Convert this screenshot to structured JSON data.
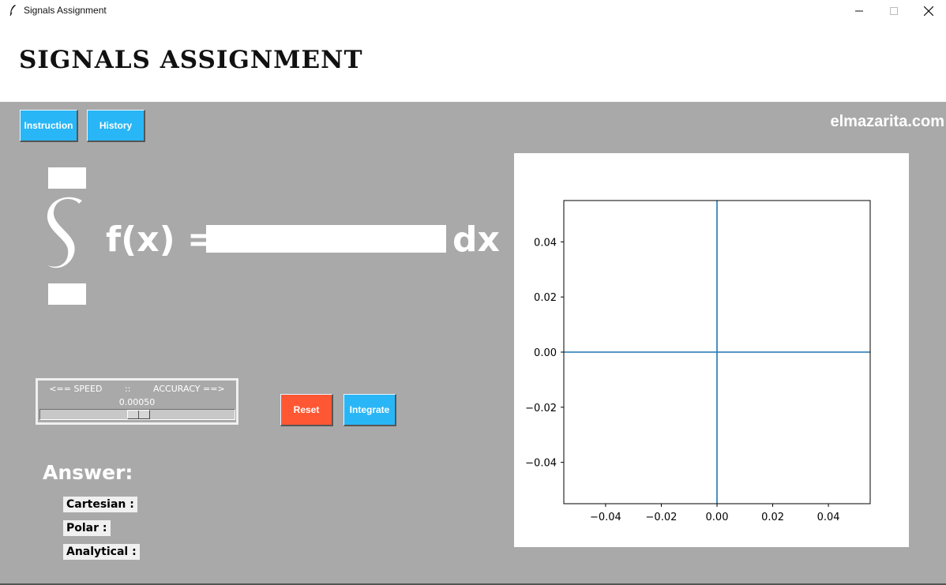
{
  "window": {
    "title": "Signals Assignment",
    "controls": [
      "minimize-icon",
      "maximize-icon",
      "close-icon"
    ]
  },
  "header": {
    "heading": "SIGNALS ASSIGNMENT"
  },
  "toolbar": {
    "instruction_label": "Instruction",
    "history_label": "History"
  },
  "site": "elmazarita.com",
  "integral": {
    "symbol": "S",
    "fx_label": "f(x) =",
    "dx_label": "dx",
    "upper_limit": "",
    "lower_limit": "",
    "function_value": ""
  },
  "scale": {
    "left_label": "<== SPEED",
    "sep_label": "::",
    "right_label": "ACCURACY ==>",
    "value": "0.00050"
  },
  "actions": {
    "reset_label": "Reset",
    "integrate_label": "Integrate"
  },
  "answer": {
    "title": "Answer:",
    "cartesian_label": "Cartesian :",
    "polar_label": "Polar :",
    "analytical_label": "Analytical :"
  },
  "colors": {
    "blue": "#29b6f6",
    "red": "#ff5733",
    "panel": "#a9a9a9",
    "line": "#1f77b4"
  },
  "chart_data": {
    "type": "line",
    "title": "",
    "xlabel": "",
    "ylabel": "",
    "xlim": [
      -0.055,
      0.055
    ],
    "ylim": [
      -0.055,
      0.055
    ],
    "xticks": [
      "−0.04",
      "−0.02",
      "0.00",
      "0.02",
      "0.04"
    ],
    "yticks": [
      "0.04",
      "0.02",
      "0.00",
      "−0.02",
      "−0.04"
    ],
    "xtick_values": [
      -0.04,
      -0.02,
      0,
      0.02,
      0.04
    ],
    "ytick_values": [
      0.04,
      0.02,
      0,
      -0.02,
      -0.04
    ],
    "series": [
      {
        "x": [
          -0.055,
          0.055
        ],
        "y": [
          0,
          0
        ]
      },
      {
        "x": [
          0,
          0
        ],
        "y": [
          -0.055,
          0.055
        ]
      }
    ],
    "grid": false
  }
}
